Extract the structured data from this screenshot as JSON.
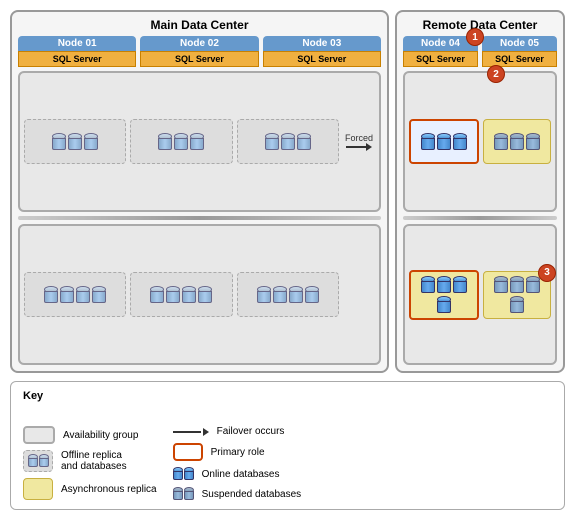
{
  "diagram": {
    "main_dc_title": "Main Data Center",
    "remote_dc_title": "Remote Data Center",
    "nodes": {
      "node01": "Node 01",
      "node02": "Node 02",
      "node03": "Node 03",
      "node04": "Node 04",
      "node05": "Node 05"
    },
    "sql_label": "SQL Server",
    "forced_label": "Forced",
    "badges": {
      "b1": "1",
      "b2": "2",
      "b3": "3"
    }
  },
  "key": {
    "title": "Key",
    "items": [
      {
        "label": "Availability group"
      },
      {
        "label": "Offline replica\nand databases"
      },
      {
        "label": "Asynchronous replica"
      },
      {
        "label": "Failover occurs"
      },
      {
        "label": "Primary role"
      },
      {
        "label": "Online databases"
      },
      {
        "label": "Suspended databases"
      }
    ]
  }
}
